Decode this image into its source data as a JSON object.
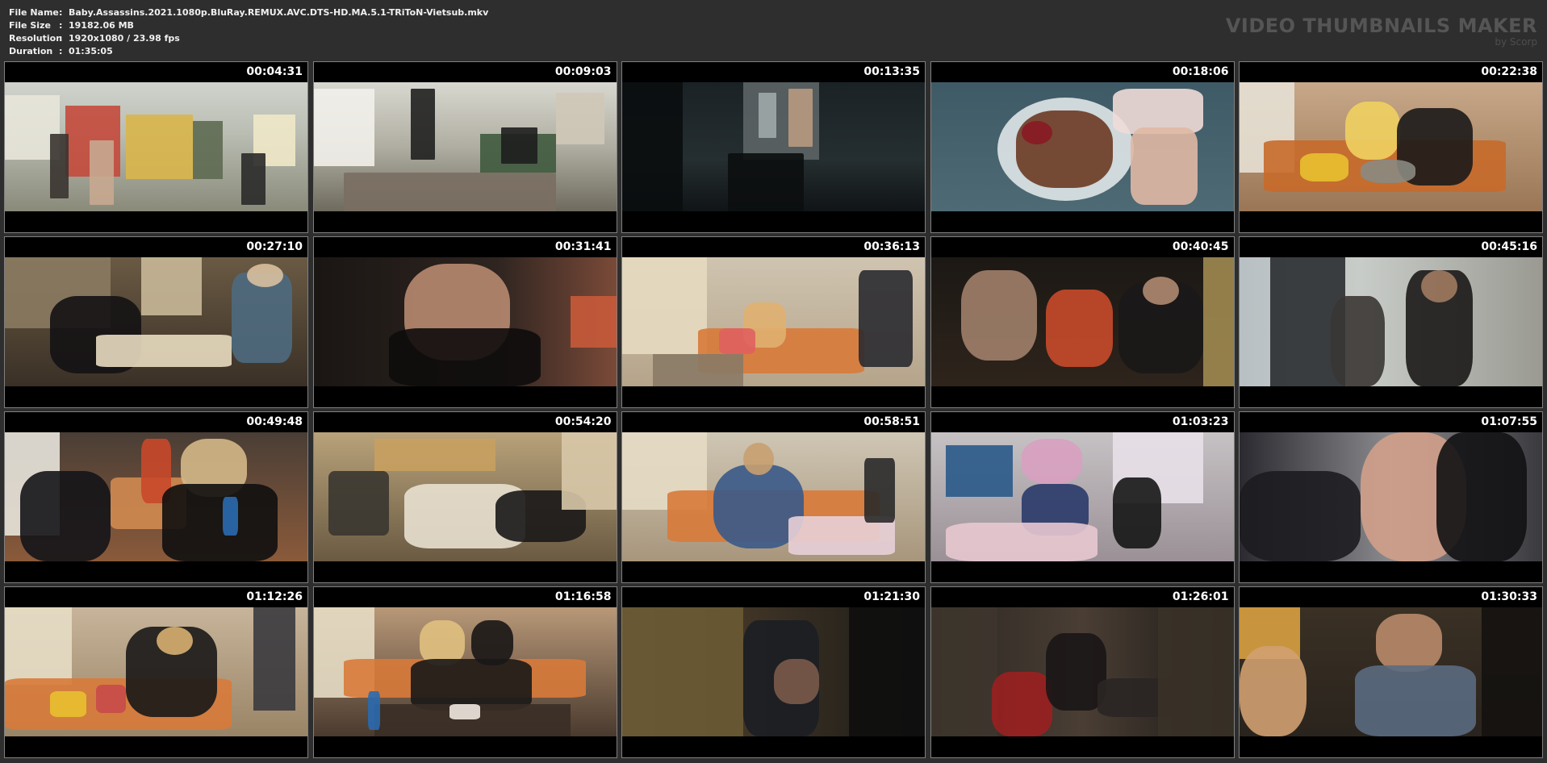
{
  "file_info": {
    "rows": [
      {
        "label": "File Name",
        "sep": ":",
        "value": "Baby.Assassins.2021.1080p.BluRay.REMUX.AVC.DTS-HD.MA.5.1-TRiToN-Vietsub.mkv"
      },
      {
        "label": "File Size",
        "sep": ":",
        "value": "19182.06 MB"
      },
      {
        "label": "Resolution",
        "sep": ":",
        "value": "1920x1080 / 23.98 fps"
      },
      {
        "label": "Duration",
        "sep": ":",
        "value": "01:35:05"
      }
    ]
  },
  "branding": {
    "title": "VIDEO THUMBNAILS MAKER",
    "subtitle": "by Scorp"
  },
  "thumbnails": [
    {
      "timestamp": "00:04:31",
      "scene": "convenience-store"
    },
    {
      "timestamp": "00:09:03",
      "scene": "store-floor"
    },
    {
      "timestamp": "00:13:35",
      "scene": "dark-doorway"
    },
    {
      "timestamp": "00:18:06",
      "scene": "waffle-cream"
    },
    {
      "timestamp": "00:22:38",
      "scene": "living-room-pair"
    },
    {
      "timestamp": "00:27:10",
      "scene": "cafe-table"
    },
    {
      "timestamp": "00:31:41",
      "scene": "man-closeup"
    },
    {
      "timestamp": "00:36:13",
      "scene": "apartment-couch"
    },
    {
      "timestamp": "00:40:45",
      "scene": "car-interior"
    },
    {
      "timestamp": "00:45:16",
      "scene": "hallway-wall"
    },
    {
      "timestamp": "00:49:48",
      "scene": "couch-bottle"
    },
    {
      "timestamp": "00:54:20",
      "scene": "messy-room"
    },
    {
      "timestamp": "00:58:51",
      "scene": "blanket-sofa"
    },
    {
      "timestamp": "01:03:23",
      "scene": "party-room"
    },
    {
      "timestamp": "01:07:55",
      "scene": "girl-profile"
    },
    {
      "timestamp": "01:12:26",
      "scene": "sofa-bending"
    },
    {
      "timestamp": "01:16:58",
      "scene": "cake-table"
    },
    {
      "timestamp": "01:21:30",
      "scene": "curtain-dark"
    },
    {
      "timestamp": "01:26:01",
      "scene": "corridor-fight"
    },
    {
      "timestamp": "01:30:33",
      "scene": "man-glasses"
    }
  ],
  "colors": {
    "background": "#2e2e2e",
    "tile_border": "#808080",
    "timestamp_text": "#ffffff",
    "brand_text": "#555555"
  }
}
